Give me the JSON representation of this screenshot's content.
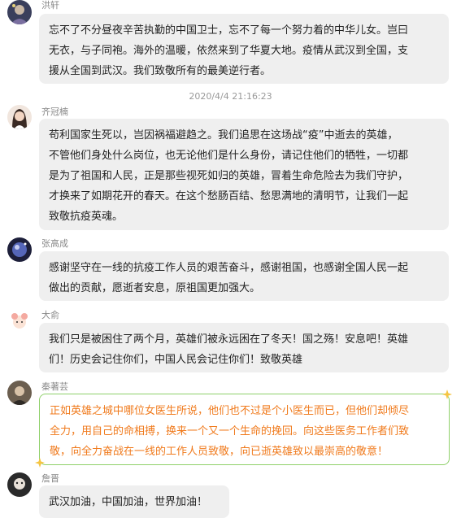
{
  "timestamp": "2020/4/4 21:16:23",
  "messages": [
    {
      "name": "洪轩",
      "lines": [
        "忘不了不分昼夜辛苦执勤的中国卫士，忘不了每一个努力着的中华儿女。岂曰",
        "无衣，与子同袍。海外的温暖，依然来到了华夏大地。疫情从武汉到全国，支",
        "援从全国到武汉。我们致敬所有的最美逆行者。"
      ]
    },
    {
      "name": "齐冠楠",
      "lines": [
        "苟利国家生死以，岂因祸福避趋之。我们追思在这场战“疫”中逝去的英雄，",
        "不管他们身处什么岗位，也无论他们是什么身份，请记住他们的牺牲，一切都",
        "是为了祖国和人民，正是那些视死如归的英雄，冒着生命危险去为我们守护，",
        "才换来了如期花开的春天。在这个愁肠百结、愁思满地的清明节，让我们一起",
        "致敬抗疫英魂。"
      ]
    },
    {
      "name": "张高成",
      "lines": [
        "感谢坚守在一线的抗疫工作人员的艰苦奋斗，感谢祖国，也感谢全国人民一起",
        "做出的贡献，愿逝者安息，原祖国更加强大。"
      ]
    },
    {
      "name": "大俞",
      "lines": [
        " 我们只是被困住了两个月，英雄们被永远困在了冬天！国之殇！安息吧！英雄",
        "们！历史会记住你们，中国人民会记住你们！致敬英雄"
      ]
    },
    {
      "name": "秦著芸",
      "lines": [
        "正如英雄之城中哪位女医生所说，他们也不过是个小医生而已，但他们却倾尽",
        "全力，用自己的命相搏，换来一个又一个生命的挽回。向这些医务工作者们致",
        "敬，向全力奋战在一线的工作人员致敬，向已逝英雄致以最崇高的敬意！"
      ]
    },
    {
      "name": "詹晋",
      "lines": [
        "武汉加油，中国加油，世界加油！"
      ]
    }
  ],
  "colors": {
    "bubble_bg": "#efefef",
    "special_text": "#f07a1c",
    "special_border": "#8fd06a",
    "name_text": "#888888",
    "timestamp_text": "#999999"
  }
}
